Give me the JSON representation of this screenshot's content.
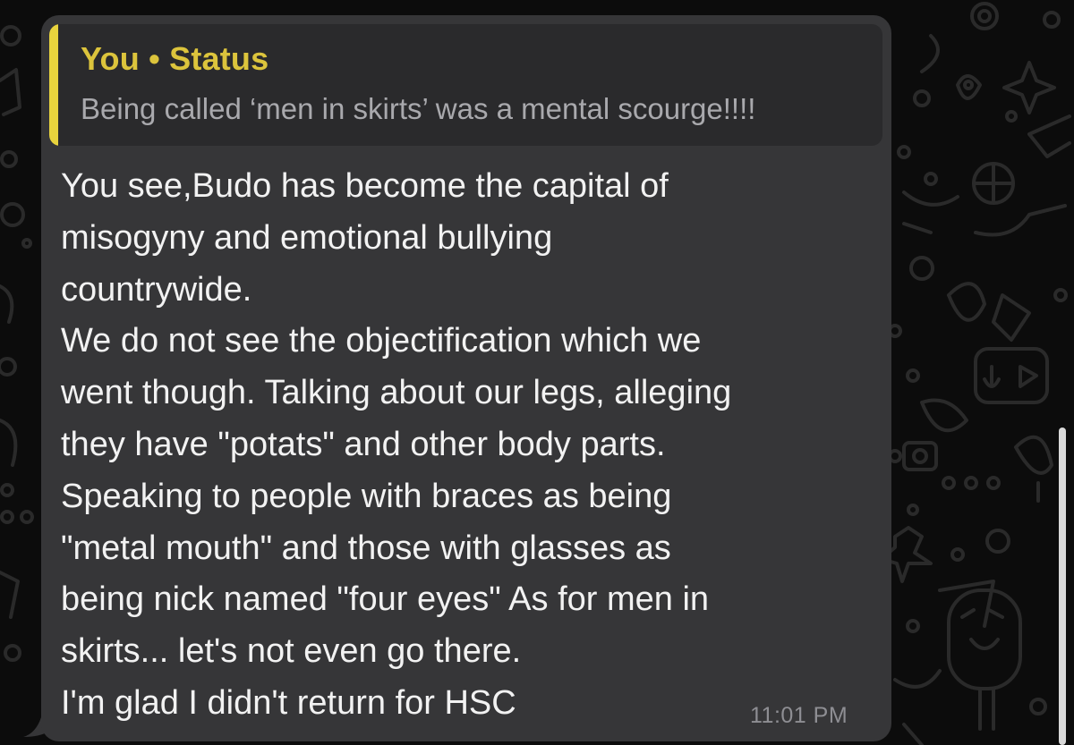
{
  "colors": {
    "background": "#0c0c0c",
    "bubble": "#363638",
    "quote_background": "#2a2a2c",
    "quote_accent": "#e8d33d",
    "quote_author": "#dcc43c",
    "message_text": "#f2f2f2",
    "timestamp": "#8e8e93"
  },
  "quoted_reply": {
    "author": "You • Status",
    "text": "Being called ‘men in skirts’ was a mental scourge!!!!"
  },
  "message": {
    "lines": [
      "You see,Budo has become the capital of",
      "misogyny and emotional bullying",
      "countrywide.",
      "We do not see the objectification which we",
      "went though. Talking about our legs, alleging",
      "they have \"potats\" and other body parts.",
      "Speaking to people with braces as being",
      "\"metal mouth\" and those with glasses as",
      "being nick named \"four eyes\" As for men in",
      "skirts... let's not even go there.",
      "I'm glad I didn't return for HSC"
    ],
    "timestamp": "11:01 PM"
  }
}
